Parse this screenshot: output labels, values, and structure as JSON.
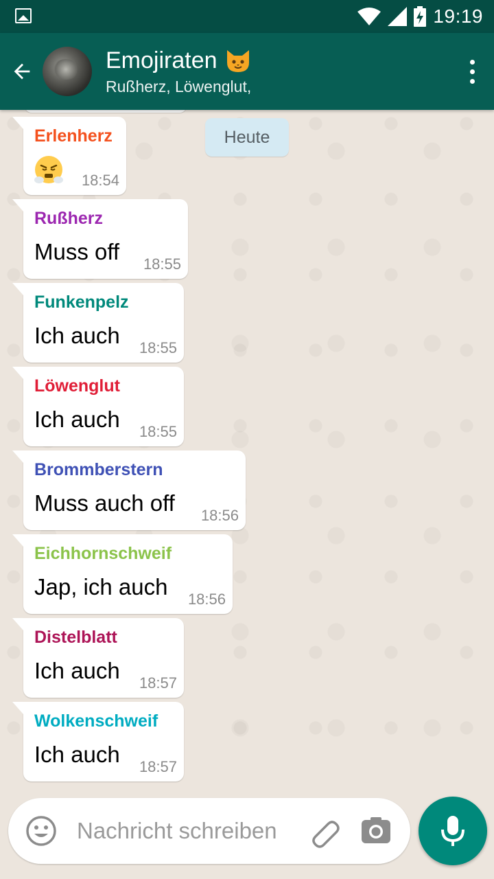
{
  "status_bar": {
    "time": "19:19",
    "icons": [
      "image-icon",
      "wifi-icon",
      "signal-icon",
      "battery-charging-icon"
    ]
  },
  "header": {
    "title": "Emojiraten",
    "title_emoji": "cat-face-icon",
    "subtitle": "Rußherz, Löwenglut,",
    "back_icon": "arrow-back-icon",
    "menu_icon": "more-vert-icon"
  },
  "date_chip": "Heute",
  "messages": [
    {
      "sender": "Erlenherz",
      "color": "#f4511e",
      "emoji": "face-with-steam-icon",
      "text": "",
      "time": "18:54"
    },
    {
      "sender": "Rußherz",
      "color": "#9c27b0",
      "text": "Muss off",
      "time": "18:55"
    },
    {
      "sender": "Funkenpelz",
      "color": "#00897b",
      "text": "Ich auch",
      "time": "18:55"
    },
    {
      "sender": "Löwenglut",
      "color": "#e01e37",
      "text": "Ich auch",
      "time": "18:55"
    },
    {
      "sender": "Brommberstern",
      "color": "#3f51b5",
      "text": "Muss auch off",
      "time": "18:56"
    },
    {
      "sender": "Eichhornschweif",
      "color": "#8bc34a",
      "text": "Jap, ich auch",
      "time": "18:56"
    },
    {
      "sender": "Distelblatt",
      "color": "#ad1457",
      "text": "Ich auch",
      "time": "18:57"
    },
    {
      "sender": "Wolkenschweif",
      "color": "#00acc1",
      "text": "Ich auch",
      "time": "18:57"
    }
  ],
  "composer": {
    "placeholder": "Nachricht schreiben",
    "value": ""
  },
  "colors": {
    "status_bar": "#054d44",
    "app_bar": "#075e54",
    "chat_bg": "#ece5dd",
    "date_chip": "#d5eaf3",
    "mic": "#00897b"
  }
}
